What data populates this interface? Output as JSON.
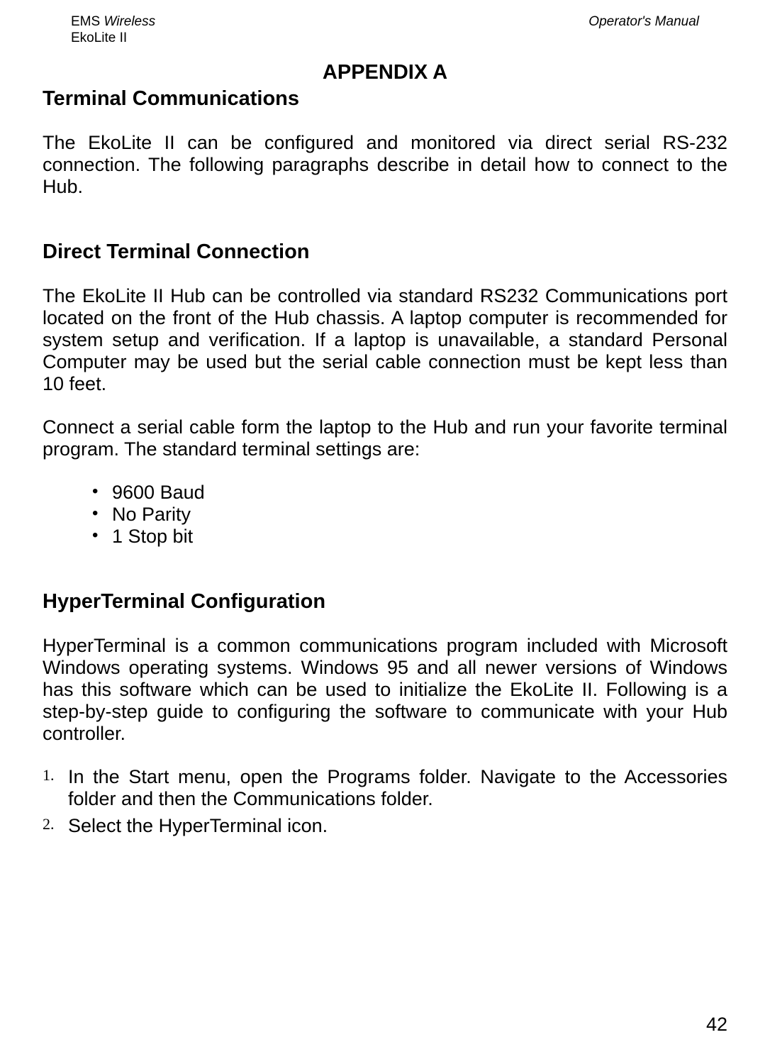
{
  "header": {
    "company_prefix": "EMS ",
    "company_suffix": "Wireless",
    "product": "EkoLite II",
    "manual_label": "Operator's Manual"
  },
  "appendix": {
    "title": "APPENDIX A"
  },
  "section1": {
    "heading": "Terminal Communications",
    "para1": "The EkoLite II can be configured and monitored via direct serial RS-232 connection.  The following paragraphs describe in detail how to connect to the Hub."
  },
  "section2": {
    "heading": "Direct Terminal Connection",
    "para1": "The EkoLite II Hub can be controlled via standard RS232 Communications port located on the front of the Hub chassis.  A laptop computer is recommended for system setup and verification.  If a laptop is unavailable, a standard Personal Computer may be used but the serial cable connection must be kept less than 10 feet.",
    "para2": "Connect a serial cable form the laptop to the Hub and run your favorite terminal program.  The standard terminal settings are:",
    "bullets": {
      "b1": "9600 Baud",
      "b2": "No Parity",
      "b3": "1 Stop bit"
    }
  },
  "section3": {
    "heading": "HyperTerminal Configuration",
    "para1": "HyperTerminal is a common communications program included with Microsoft Windows operating systems.  Windows 95 and all newer versions of Windows has this software which can be used to initialize the EkoLite II.  Following is a step-by-step guide to configuring the software to communicate with your Hub controller.",
    "steps": {
      "n1": "1.",
      "s1": "In the Start menu, open the Programs folder. Navigate to the Accessories folder and then the Communications folder.",
      "n2": "2.",
      "s2": "Select the HyperTerminal icon."
    }
  },
  "page_number": "42"
}
